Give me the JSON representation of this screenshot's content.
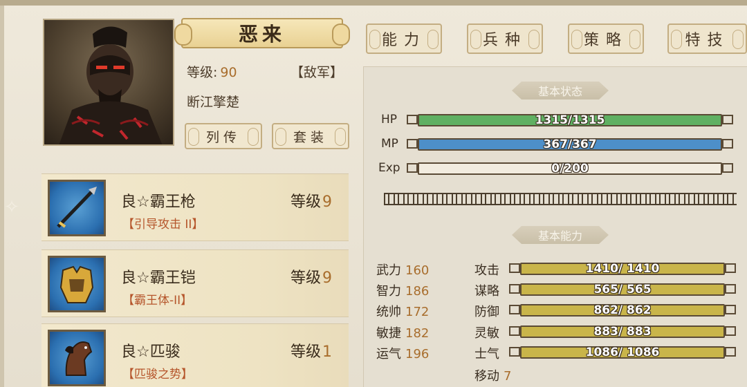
{
  "character": {
    "name": "恶来",
    "level_label": "等级:",
    "level_value": "90",
    "faction": "【敌军】",
    "title": "断江擎楚"
  },
  "buttons": {
    "biography": "列传",
    "equipment_set": "套装"
  },
  "equipment": [
    {
      "name": "良☆霸王枪",
      "level_label": "等级",
      "level": "9",
      "skill": "【引导攻击 II】",
      "icon": "spear-icon"
    },
    {
      "name": "良☆霸王铠",
      "level_label": "等级",
      "level": "9",
      "skill": "【霸王体-II】",
      "icon": "armor-icon"
    },
    {
      "name": "良☆匹骏",
      "level_label": "等级",
      "level": "1",
      "skill": "【匹骏之势】",
      "icon": "horse-icon"
    }
  ],
  "tabs": {
    "ability": "能力",
    "troop": "兵种",
    "strategy": "策略",
    "skill": "特技"
  },
  "basic_status": {
    "header": "基本状态",
    "hp_label": "HP",
    "hp_text": "1315/1315",
    "hp_fraction": 1.0,
    "mp_label": "MP",
    "mp_text": "367/367",
    "mp_fraction": 1.0,
    "exp_label": "Exp",
    "exp_text": "0/200",
    "exp_fraction": 0.0
  },
  "basic_ability": {
    "header": "基本能力",
    "stats": [
      {
        "name": "武力",
        "value": "160"
      },
      {
        "name": "智力",
        "value": "186"
      },
      {
        "name": "统帅",
        "value": "172"
      },
      {
        "name": "敏捷",
        "value": "182"
      },
      {
        "name": "运气",
        "value": "196"
      }
    ],
    "bars": [
      {
        "name": "攻击",
        "text": "1410/ 1410"
      },
      {
        "name": "谋略",
        "text": "565/ 565"
      },
      {
        "name": "防御",
        "text": "862/ 862"
      },
      {
        "name": "灵敏",
        "text": "883/ 883"
      },
      {
        "name": "士气",
        "text": "1086/ 1086"
      }
    ],
    "move_label": "移动",
    "move_value": "7"
  },
  "colors": {
    "hp": "#5fb062",
    "mp": "#4d8fc9",
    "ability": "#c9b54a",
    "value": "#a86d2c"
  }
}
